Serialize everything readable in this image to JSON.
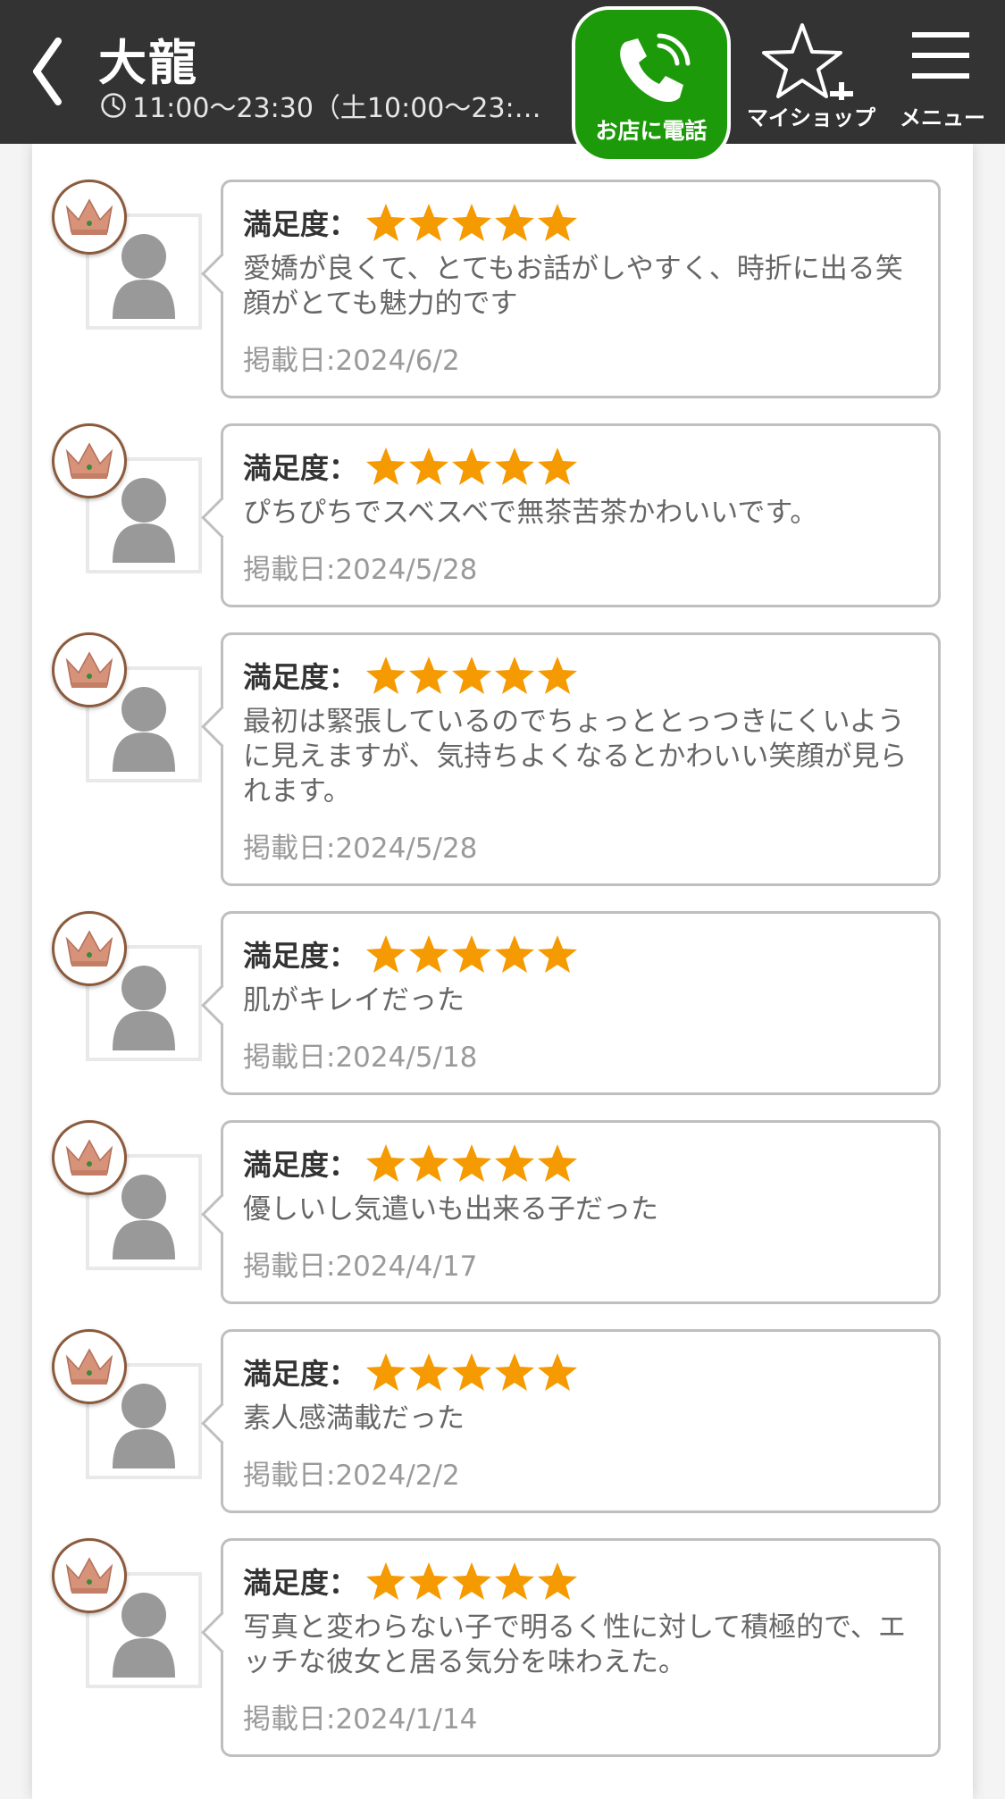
{
  "header": {
    "back_icon": "chevron-left-icon",
    "shop_name": "大龍",
    "hours": "11:00〜23:30（土10:00〜23:…",
    "call_label": "お店に電話",
    "myshop_label": "マイショップ",
    "menu_label": "メニュー",
    "call_color": "#1d9a0a",
    "header_color": "#333333"
  },
  "reviews": [
    {
      "rating_label": "満足度：",
      "stars": 5,
      "comment": "愛嬌が良くて、とてもお話がしやすく、時折に出る笑顔がとても魅力的です",
      "date": "掲載日:2024/6/2"
    },
    {
      "rating_label": "満足度：",
      "stars": 5,
      "comment": "ぴちぴちでスベスベで無茶苦茶かわいいです。",
      "date": "掲載日:2024/5/28"
    },
    {
      "rating_label": "満足度：",
      "stars": 5,
      "comment": "最初は緊張しているのでちょっととっつきにくいように見えますが、気持ちよくなるとかわいい笑顔が見られます。",
      "date": "掲載日:2024/5/28"
    },
    {
      "rating_label": "満足度：",
      "stars": 5,
      "comment": "肌がキレイだった",
      "date": "掲載日:2024/5/18"
    },
    {
      "rating_label": "満足度：",
      "stars": 5,
      "comment": "優しいし気遣いも出来る子だった",
      "date": "掲載日:2024/4/17"
    },
    {
      "rating_label": "満足度：",
      "stars": 5,
      "comment": "素人感満載だった",
      "date": "掲載日:2024/2/2"
    },
    {
      "rating_label": "満足度：",
      "stars": 5,
      "comment": "写真と変わらない子で明るく性に対して積極的で、エッチな彼女と居る気分を味わえた。",
      "date": "掲載日:2024/1/14"
    }
  ],
  "colors": {
    "star": "#f59a00",
    "crown": "#d6937a"
  }
}
